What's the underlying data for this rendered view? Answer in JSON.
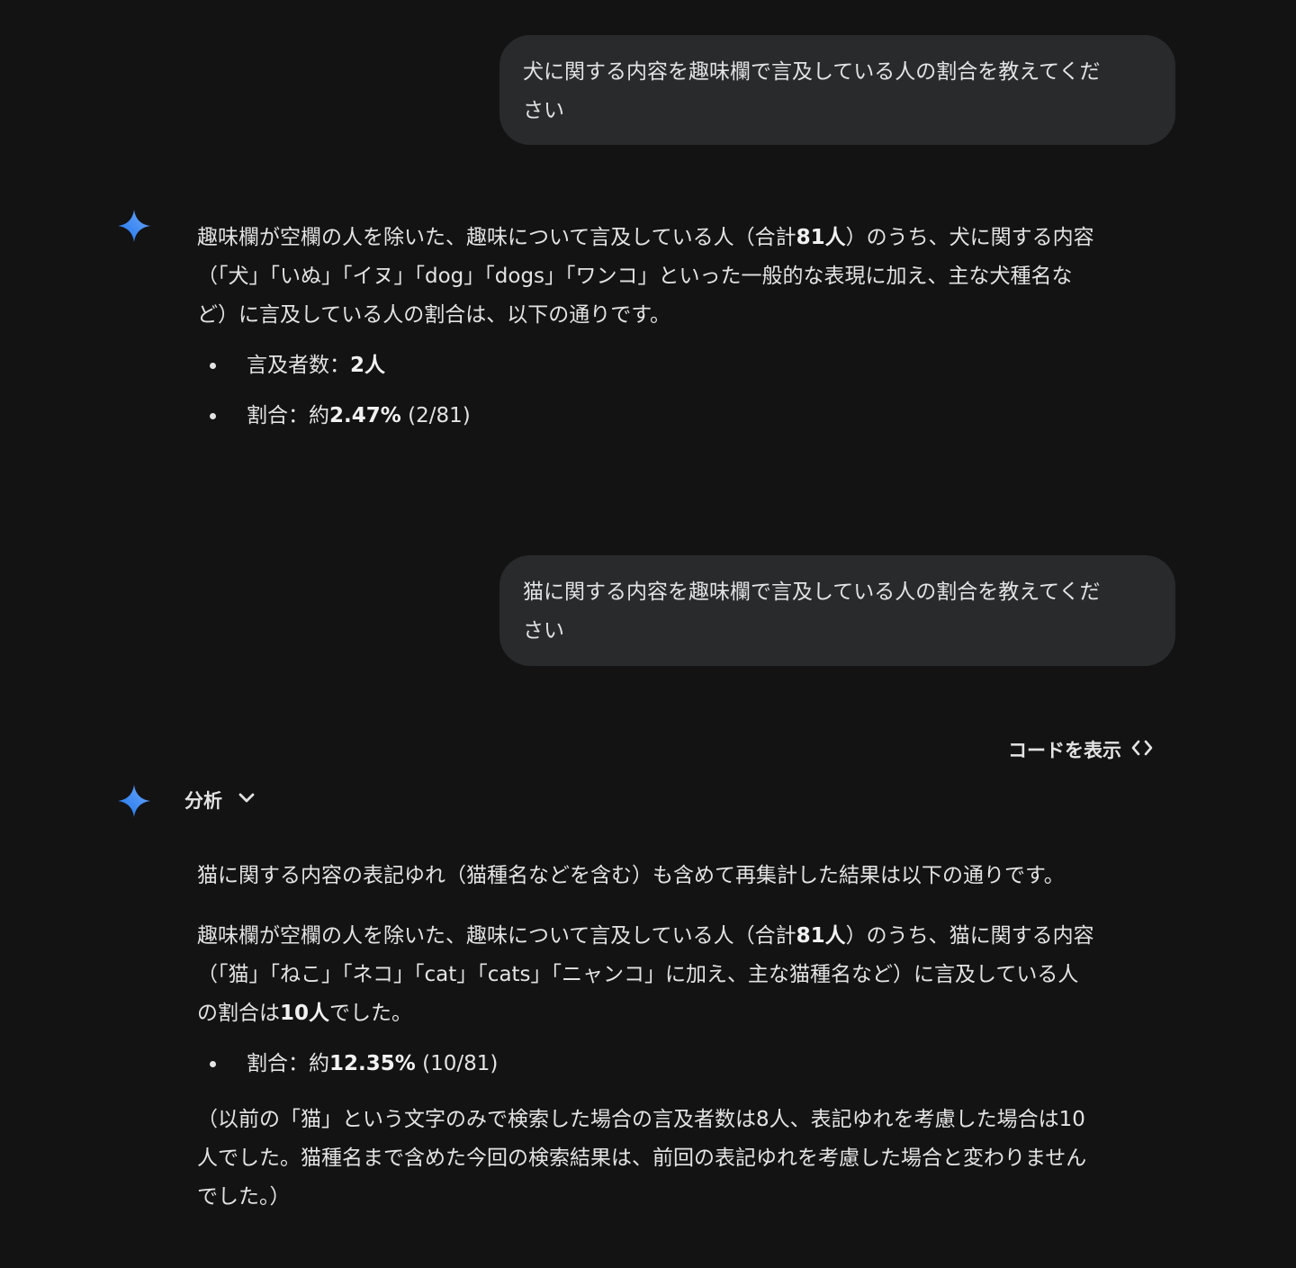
{
  "conversation": {
    "user_message_1": {
      "line1": "犬に関する内容を趣味欄で言及している人の割合を教えてくだ",
      "line2": "さい"
    },
    "response_1": {
      "paragraph_1": {
        "part_a": "趣味欄が空欄の人を除いた、趣味について言及している人（合計",
        "total_bold": "81人",
        "part_b": "）のうち、犬に関する内容",
        "line2": "（「犬」「いぬ」「イヌ」「dog」「dogs」「ワンコ」といった一般的な表現に加え、主な犬種名な",
        "line3": "ど）に言及している人の割合は、以下の通りです。"
      },
      "bullet_1": {
        "label": "言及者数：",
        "value_bold": "2人",
        "suffix": ""
      },
      "bullet_2": {
        "label": "割合：約",
        "value_bold": "2.47%",
        "suffix": " (2/81)"
      }
    },
    "user_message_2": {
      "line1": "猫に関する内容を趣味欄で言及している人の割合を教えてくだ",
      "line2": "さい"
    },
    "response_2": {
      "show_code_label": "コードを表示",
      "analysis_label": "分析",
      "paragraph_1": "猫に関する内容の表記ゆれ（猫種名などを含む）も含めて再集計した結果は以下の通りです。",
      "paragraph_2": {
        "part_a": "趣味欄が空欄の人を除いた、趣味について言及している人（合計",
        "total_bold": "81人",
        "part_b": "）のうち、猫に関する内容",
        "line2": "（「猫」「ねこ」「ネコ」「cat」「cats」「ニャンコ」に加え、主な猫種名など）に言及している人",
        "line3_a": "の割合は",
        "count_bold": "10人",
        "line3_b": "でした。"
      },
      "bullet_1": {
        "label": "割合：約",
        "value_bold": "12.35%",
        "suffix": " (10/81)"
      },
      "paragraph_3": {
        "line1": "（以前の「猫」という文字のみで検索した場合の言及者数は8人、表記ゆれを考慮した場合は10",
        "line2": "人でした。猫種名まで含めた今回の検索結果は、前回の表記ゆれを考慮した場合と変わりません",
        "line3": "でした。）"
      }
    }
  },
  "icons": {
    "assistant": "gemini-sparkle-icon",
    "code": "code-brackets-icon",
    "expand": "chevron-down-icon"
  },
  "colors": {
    "background": "#131314",
    "user_bubble": "#282a2c",
    "text": "#e3e3e3",
    "sparkle_blue": "#4285f4"
  }
}
